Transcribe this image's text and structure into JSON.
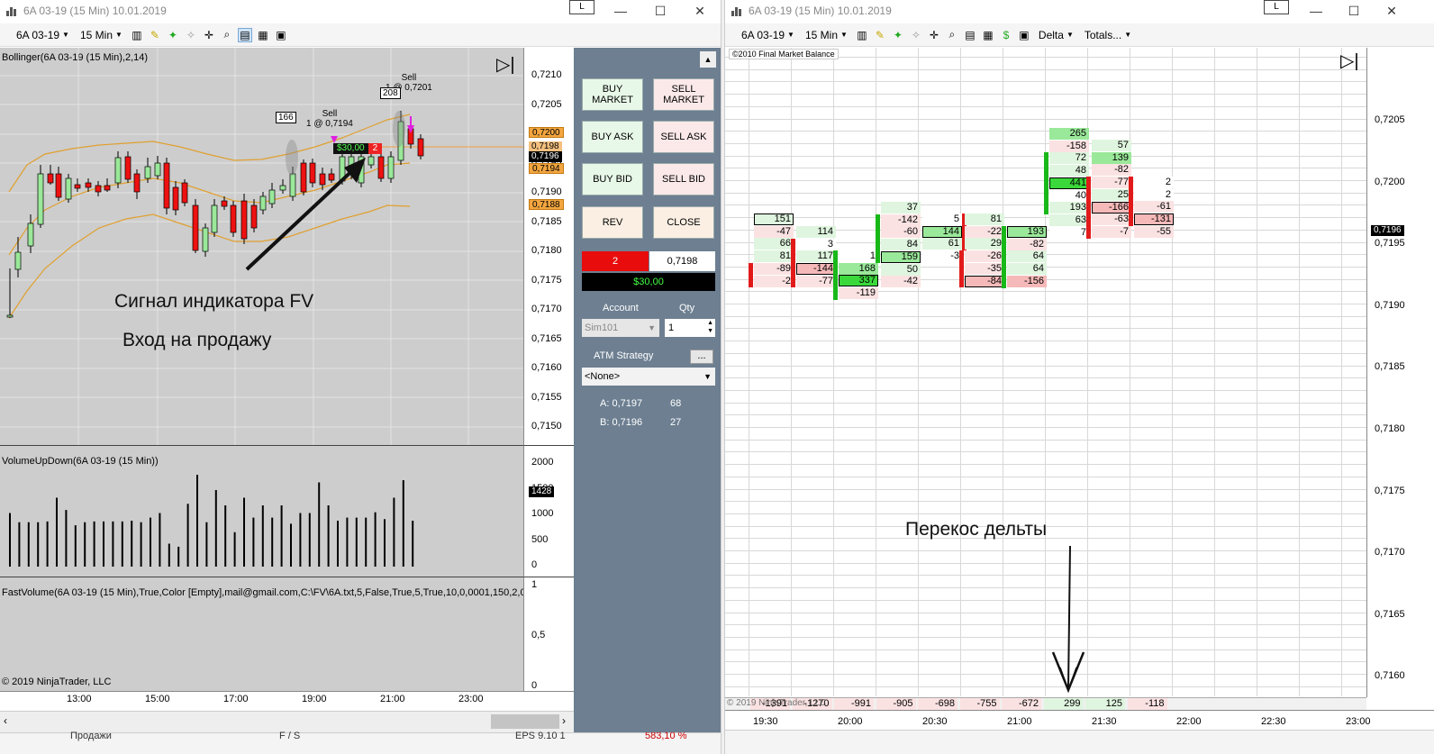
{
  "left_window": {
    "title": "6A 03-19 (15 Min)  10.01.2019",
    "l_button": "L",
    "toolbar": {
      "instrument": "6A 03-19",
      "interval": "15 Min"
    },
    "price_panel": {
      "indicator_label": "Bollinger(6A 03-19 (15 Min),2,14)",
      "price_ticks": [
        "0,7210",
        "0,7205",
        "0,7200",
        "0,7195",
        "0,7190",
        "0,7185",
        "0,7180",
        "0,7175",
        "0,7170",
        "0,7165",
        "0,7160",
        "0,7155",
        "0,7150"
      ],
      "badges": {
        "upper": "0,7200",
        "mid1": "0,7198",
        "last": "0,7196",
        "lower1": "0,7194",
        "lower2": "0,7188"
      },
      "trade_label_1": {
        "line1": "Sell",
        "line2": "1 @ 0,7194"
      },
      "trade_label_2": {
        "line1": "Sell",
        "line2": "1 @ 0,7201"
      },
      "bar_count_1": "166",
      "bar_count_2": "208",
      "pnl_flag": "$30,00",
      "pnl_qty": "2",
      "annotation_1": "Сигнал индикатора FV",
      "annotation_2": "Вход на продажу"
    },
    "volume_panel": {
      "label": "VolumeUpDown(6A 03-19 (15 Min))",
      "ticks": [
        "2000",
        "1500",
        "1000",
        "500",
        "0"
      ],
      "badge": "1428"
    },
    "fv_panel": {
      "label": "FastVolume(6A 03-19 (15 Min),True,Color [Empty],mail@gmail.com,C:\\FV\\6A.txt,5,False,True,5,True,10,0,0001,150,2,0(",
      "ticks": [
        "1",
        "0,5",
        "0"
      ],
      "copyright": "© 2019 NinjaTrader, LLC"
    },
    "time_ticks": [
      "13:00",
      "15:00",
      "17:00",
      "19:00",
      "21:00",
      "23:00"
    ],
    "order_panel": {
      "buy_market": "BUY\nMARKET",
      "sell_market": "SELL\nMARKET",
      "buy_ask": "BUY ASK",
      "sell_ask": "SELL ASK",
      "buy_bid": "BUY BID",
      "sell_bid": "SELL BID",
      "rev": "REV",
      "close": "CLOSE",
      "position_qty": "2",
      "position_price": "0,7198",
      "position_pnl": "$30,00",
      "account_label": "Account",
      "qty_label": "Qty",
      "account_value": "Sim101",
      "qty_value": "1",
      "atm_label": "ATM Strategy",
      "atm_btn": "...",
      "atm_value": "<None>",
      "ask_label": "A: 0,7197",
      "ask_size": "68",
      "bid_label": "B: 0,7196",
      "bid_size": "27"
    },
    "bottom_strip": {
      "c1": "Продажи",
      "c2": "F / S",
      "c3": "EPS 9.10 1",
      "c4": "583,10 %"
    }
  },
  "right_window": {
    "title": "6A 03-19 (15 Min)  10.01.2019",
    "l_button": "L",
    "toolbar": {
      "instrument": "6A 03-19",
      "interval": "15 Min",
      "delta": "Delta",
      "totals": "Totals..."
    },
    "copyright_top": "©2010 Final Market Balance",
    "price_ticks": [
      "0,7205",
      "0,7200",
      "0,7195",
      "0,7190",
      "0,7185",
      "0,7180",
      "0,7175",
      "0,7170",
      "0,7165",
      "0,7160"
    ],
    "last_price": "0,7196",
    "annotation": "Перекос дельты",
    "totals": [
      "-1391",
      "-1270",
      "-991",
      "-905",
      "-698",
      "-755",
      "-672",
      "299",
      "125",
      "-118"
    ],
    "totals_overlay": "© 2019 NinjaTrader, LLC",
    "time_ticks": [
      "19:30",
      "20:00",
      "20:30",
      "21:00",
      "21:30",
      "22:00",
      "22:30",
      "23:00"
    ]
  },
  "footprint": [
    {
      "col": 0,
      "cells": [
        [
          "151",
          "g",
          1
        ],
        [
          "-47",
          "r",
          0
        ],
        [
          "66",
          "g",
          0
        ],
        [
          "81",
          "g",
          0
        ],
        [
          "-89",
          "r",
          0
        ],
        [
          "-2",
          "r",
          0
        ]
      ]
    },
    {
      "col": 1,
      "cells": [
        [
          "114",
          "g",
          0
        ],
        [
          "3",
          "w",
          0
        ],
        [
          "117",
          "g",
          0
        ],
        [
          "-144",
          "rr",
          1
        ],
        [
          "-77",
          "r",
          0
        ]
      ]
    },
    {
      "col": 2,
      "cells": [
        [
          "1",
          "w",
          0
        ],
        [
          "168",
          "gg",
          0
        ],
        [
          "337",
          "G",
          1
        ],
        [
          "-119",
          "r",
          0
        ]
      ]
    },
    {
      "col": 3,
      "cells": [
        [
          "37",
          "g",
          0
        ],
        [
          "-142",
          "r",
          0
        ],
        [
          "-60",
          "r",
          0
        ],
        [
          "84",
          "g",
          0
        ],
        [
          "159",
          "gg",
          1
        ],
        [
          "50",
          "g",
          0
        ],
        [
          "-42",
          "r",
          0
        ]
      ]
    },
    {
      "col": 4,
      "cells": [
        [
          "5",
          "w",
          0
        ],
        [
          "144",
          "gg",
          1
        ],
        [
          "61",
          "g",
          0
        ],
        [
          "-3",
          "w",
          0
        ]
      ]
    },
    {
      "col": 5,
      "cells": [
        [
          "81",
          "g",
          0
        ],
        [
          "-22",
          "r",
          0
        ],
        [
          "29",
          "g",
          0
        ],
        [
          "-26",
          "r",
          0
        ],
        [
          "-35",
          "r",
          0
        ],
        [
          "-84",
          "rr",
          1
        ]
      ]
    },
    {
      "col": 6,
      "cells": [
        [
          "193",
          "gg",
          1
        ],
        [
          "-82",
          "r",
          0
        ],
        [
          "64",
          "g",
          0
        ],
        [
          "64",
          "g",
          0
        ],
        [
          "-156",
          "rr",
          0
        ]
      ]
    },
    {
      "col": 7,
      "cells": [
        [
          "265",
          "gg",
          0
        ],
        [
          "-158",
          "r",
          0
        ],
        [
          "72",
          "g",
          0
        ],
        [
          "48",
          "g",
          0
        ],
        [
          "441",
          "G",
          1
        ],
        [
          "40",
          "w",
          0
        ],
        [
          "193",
          "g",
          0
        ],
        [
          "63",
          "g",
          0
        ],
        [
          "7",
          "w",
          0
        ]
      ]
    },
    {
      "col": 8,
      "cells": [
        [
          "57",
          "g",
          0
        ],
        [
          "139",
          "gg",
          0
        ],
        [
          "-82",
          "r",
          0
        ],
        [
          "-77",
          "r",
          0
        ],
        [
          "25",
          "g",
          0
        ],
        [
          "-166",
          "rr",
          1
        ],
        [
          "-63",
          "r",
          0
        ],
        [
          "-7",
          "r",
          0
        ]
      ]
    },
    {
      "col": 9,
      "cells": [
        [
          "2",
          "w",
          0
        ],
        [
          "2",
          "w",
          0
        ],
        [
          "-61",
          "r",
          0
        ],
        [
          "-131",
          "rr",
          1
        ],
        [
          "-55",
          "r",
          0
        ]
      ]
    }
  ]
}
